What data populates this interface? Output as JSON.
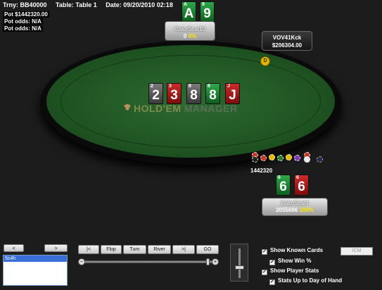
{
  "header": {
    "tournament": "Trny: BB40000",
    "table": "Table: Table 1",
    "date": "Date: 09/20/2010 02:18"
  },
  "pot_info": {
    "pot": "Pot $1442320.00",
    "pot_odds_1": "Pot odds: N/A",
    "pot_odds_2": "Pot odds: N/A"
  },
  "watermark": {
    "part1": "HOLD'EM",
    "part2": "MANAGER"
  },
  "seats": {
    "top": {
      "name": "CakeSeat10",
      "stack": "0",
      "percent": "0%",
      "cards": [
        {
          "rank": "A",
          "big": "A",
          "color": "green"
        },
        {
          "rank": "9",
          "big": "9",
          "color": "green"
        }
      ]
    },
    "right": {
      "name": "VOV41Kck",
      "stack": "$206304.00"
    },
    "bottom": {
      "name": "CakeSeat4",
      "stack": "2055696",
      "percent": "100%",
      "cards": [
        {
          "rank": "6",
          "big": "6",
          "color": "green"
        },
        {
          "rank": "6",
          "big": "6",
          "color": "red"
        }
      ]
    }
  },
  "board": [
    {
      "rank": "2",
      "big": "2",
      "color": "gray"
    },
    {
      "rank": "3",
      "big": "3",
      "color": "red"
    },
    {
      "rank": "8",
      "big": "8",
      "color": "gray"
    },
    {
      "rank": "8",
      "big": "8",
      "color": "green"
    },
    {
      "rank": "J",
      "big": "J",
      "color": "red"
    }
  ],
  "dealer_label": "D",
  "pot_amount": "1442320",
  "controls": {
    "prev_label": "<",
    "next_label": ">",
    "list_items": [
      "5c4h"
    ],
    "buttons": [
      "|<",
      "Flop",
      "Turn",
      "River",
      ">|",
      "GO"
    ],
    "slider_minus": "−",
    "slider_plus": "+",
    "icm_label": "ICM"
  },
  "options": [
    {
      "label": "Show Known Cards",
      "checked": true
    },
    {
      "label": "Show Win %",
      "checked": true
    },
    {
      "label": "Show Player Stats",
      "checked": true
    },
    {
      "label": "Stats Up to Day of Hand",
      "checked": true
    }
  ],
  "colors": {
    "gray": "#555555",
    "red": "#b01c1c",
    "green": "#1e8a36",
    "felt": "#1f5422",
    "highlight": "#ffe400"
  }
}
